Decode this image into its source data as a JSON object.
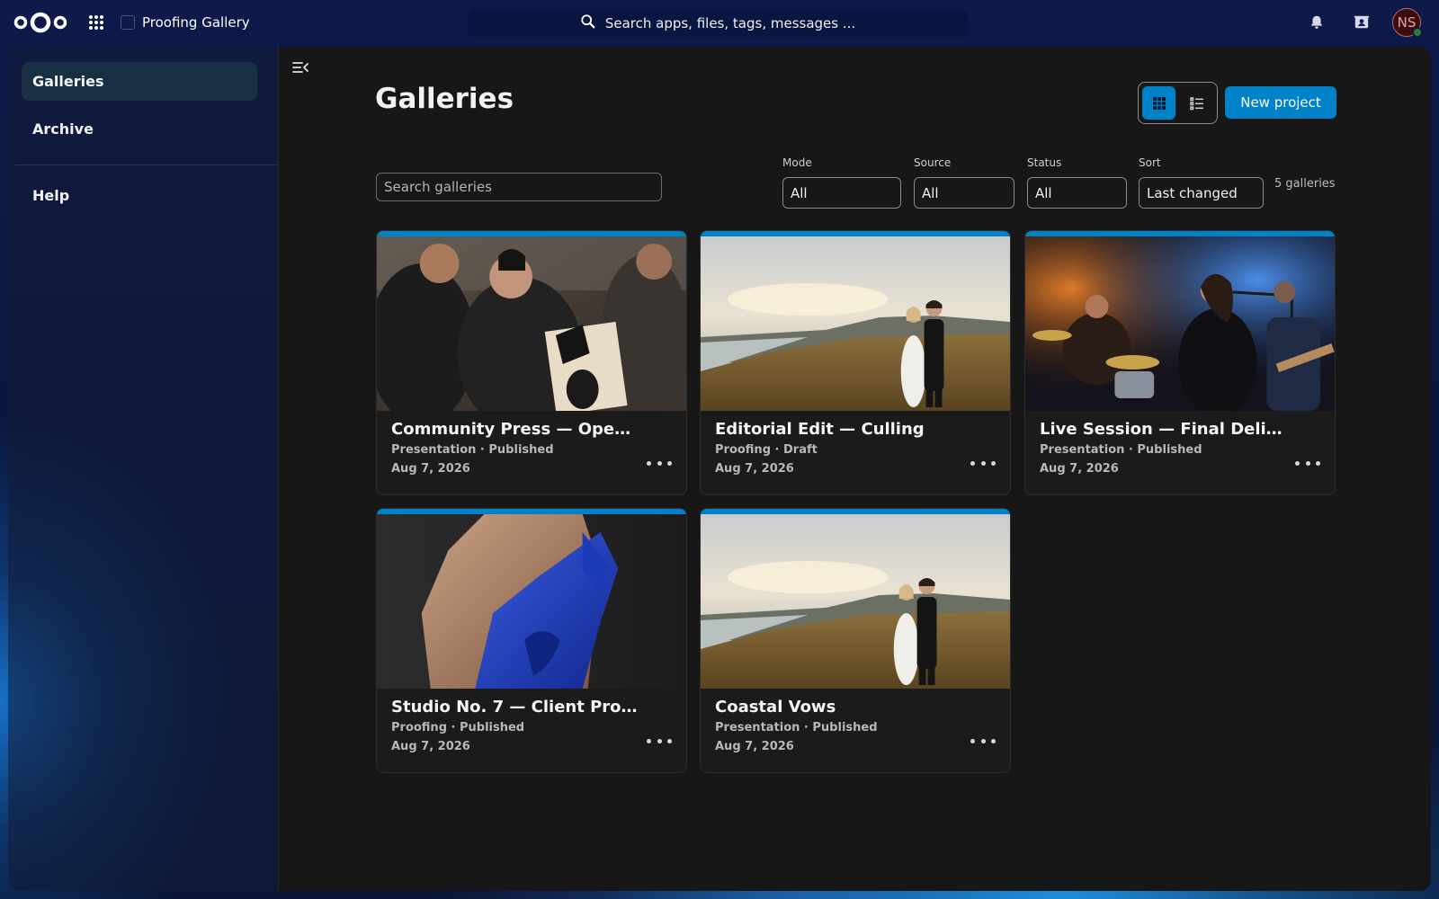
{
  "header": {
    "app_title": "Proofing Gallery",
    "search_placeholder": "Search apps, files, tags, messages ...",
    "avatar_initials": "NS",
    "icons": [
      "nextcloud-logo",
      "apps-grid-icon",
      "search-icon",
      "bell-icon",
      "contacts-icon"
    ]
  },
  "sidebar": {
    "items": [
      {
        "label": "Galleries",
        "active": true
      },
      {
        "label": "Archive",
        "active": false
      },
      {
        "label": "Help",
        "active": false
      }
    ]
  },
  "main": {
    "title": "Galleries",
    "view_toggle": {
      "active": "grid",
      "grid_icon": "grid-view-icon",
      "list_icon": "list-view-icon"
    },
    "new_project_label": "New project",
    "search_placeholder": "Search galleries",
    "filters": [
      {
        "label": "Mode",
        "value": "All"
      },
      {
        "label": "Source",
        "value": "All"
      },
      {
        "label": "Status",
        "value": "All"
      },
      {
        "label": "Sort",
        "value": "Last changed"
      }
    ],
    "count_label": "5 galleries",
    "cards": [
      {
        "title": "Community Press — Ope…",
        "meta": "Presentation · Published",
        "date": "Aug 7, 2026",
        "image": "printmaking workshop photo"
      },
      {
        "title": "Editorial Edit — Culling",
        "meta": "Proofing · Draft",
        "date": "Aug 7, 2026",
        "image": "coastal wedding couple photo"
      },
      {
        "title": "Live Session — Final Deli…",
        "meta": "Presentation · Published",
        "date": "Aug 7, 2026",
        "image": "live band concert photo"
      },
      {
        "title": "Studio No. 7 — Client Pro…",
        "meta": "Proofing · Published",
        "date": "Aug 7, 2026",
        "image": "blue fashion dress photo"
      },
      {
        "title": "Coastal Vows",
        "meta": "Presentation · Published",
        "date": "Aug 7, 2026",
        "image": "coastal wedding couple photo"
      }
    ]
  },
  "colors": {
    "accent": "#0082c9",
    "background": "#171717",
    "header_bg": "#0d1a4a"
  }
}
